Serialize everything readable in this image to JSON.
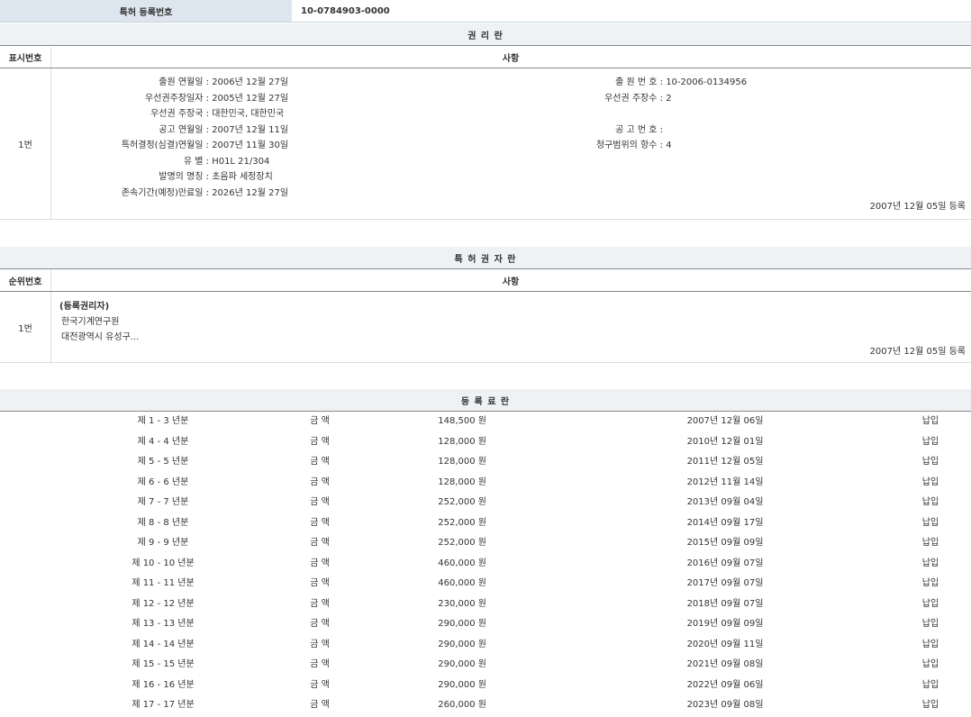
{
  "header": {
    "label": "특허 등록번호",
    "value": "10-0784903-0000"
  },
  "rights_section": {
    "title": "권 리 란",
    "col_num": "표시번호",
    "col_content": "사항",
    "row_num": "1번",
    "left_items": [
      {
        "k": "출원 연월일 :",
        "v": "2006년 12월 27일"
      },
      {
        "k": "우선권주장일자 :",
        "v": "2005년 12월 27일"
      },
      {
        "k": "우선권 주장국 :",
        "v": "대한민국, 대한민국"
      },
      {
        "k": "공고 연월일 :",
        "v": "2007년 12월 11일"
      },
      {
        "k": "특허결정(심결)연월일 :",
        "v": "2007년 11월 30일"
      },
      {
        "k": "유 별 :",
        "v": "H01L 21/304"
      },
      {
        "k": "발명의 명칭 :",
        "v": "초음파 세정장치"
      },
      {
        "k": "존속기간(예정)만료일 :",
        "v": "2026년 12월 27일"
      }
    ],
    "right_items": [
      {
        "k": "출 원 번 호 :",
        "v": "10-2006-0134956"
      },
      {
        "k": "우선권 주장수 :",
        "v": "2"
      },
      {
        "k": "공 고 번 호 :",
        "v": ""
      },
      {
        "k": "청구범위의 항수 :",
        "v": "4"
      }
    ],
    "reg_date": "2007년 12월 05일 등록"
  },
  "holder_section": {
    "title": "특 허 권 자 란",
    "col_num": "순위번호",
    "col_content": "사항",
    "row_num": "1번",
    "holder_type": "(등록권리자)",
    "holder_name": "한국기계연구원",
    "holder_address": "대전광역시 유성구...",
    "reg_date": "2007년 12월 05일 등록"
  },
  "fee_section": {
    "title": "등 록 료 란",
    "rows": [
      {
        "period": "제 1 - 3 년분",
        "label": "금 액",
        "amount": "148,500 원",
        "date": "2007년 12월 06일",
        "status": "납입"
      },
      {
        "period": "제 4 - 4 년분",
        "label": "금 액",
        "amount": "128,000 원",
        "date": "2010년 12월 01일",
        "status": "납입"
      },
      {
        "period": "제 5 - 5 년분",
        "label": "금 액",
        "amount": "128,000 원",
        "date": "2011년 12월 05일",
        "status": "납입"
      },
      {
        "period": "제 6 - 6 년분",
        "label": "금 액",
        "amount": "128,000 원",
        "date": "2012년 11월 14일",
        "status": "납입"
      },
      {
        "period": "제 7 - 7 년분",
        "label": "금 액",
        "amount": "252,000 원",
        "date": "2013년 09월 04일",
        "status": "납입"
      },
      {
        "period": "제 8 - 8 년분",
        "label": "금 액",
        "amount": "252,000 원",
        "date": "2014년 09월 17일",
        "status": "납입"
      },
      {
        "period": "제 9 - 9 년분",
        "label": "금 액",
        "amount": "252,000 원",
        "date": "2015년 09월 09일",
        "status": "납입"
      },
      {
        "period": "제 10 - 10 년분",
        "label": "금 액",
        "amount": "460,000 원",
        "date": "2016년 09월 07일",
        "status": "납입"
      },
      {
        "period": "제 11 - 11 년분",
        "label": "금 액",
        "amount": "460,000 원",
        "date": "2017년 09월 07일",
        "status": "납입"
      },
      {
        "period": "제 12 - 12 년분",
        "label": "금 액",
        "amount": "230,000 원",
        "date": "2018년 09월 07일",
        "status": "납입"
      },
      {
        "period": "제 13 - 13 년분",
        "label": "금 액",
        "amount": "290,000 원",
        "date": "2019년 09월 09일",
        "status": "납입"
      },
      {
        "period": "제 14 - 14 년분",
        "label": "금 액",
        "amount": "290,000 원",
        "date": "2020년 09월 11일",
        "status": "납입"
      },
      {
        "period": "제 15 - 15 년분",
        "label": "금 액",
        "amount": "290,000 원",
        "date": "2021년 09월 08일",
        "status": "납입"
      },
      {
        "period": "제 16 - 16 년분",
        "label": "금 액",
        "amount": "290,000 원",
        "date": "2022년 09월 06일",
        "status": "납입"
      },
      {
        "period": "제 17 - 17 년분",
        "label": "금 액",
        "amount": "260,000 원",
        "date": "2023년 09월 08일",
        "status": "납입"
      }
    ]
  }
}
